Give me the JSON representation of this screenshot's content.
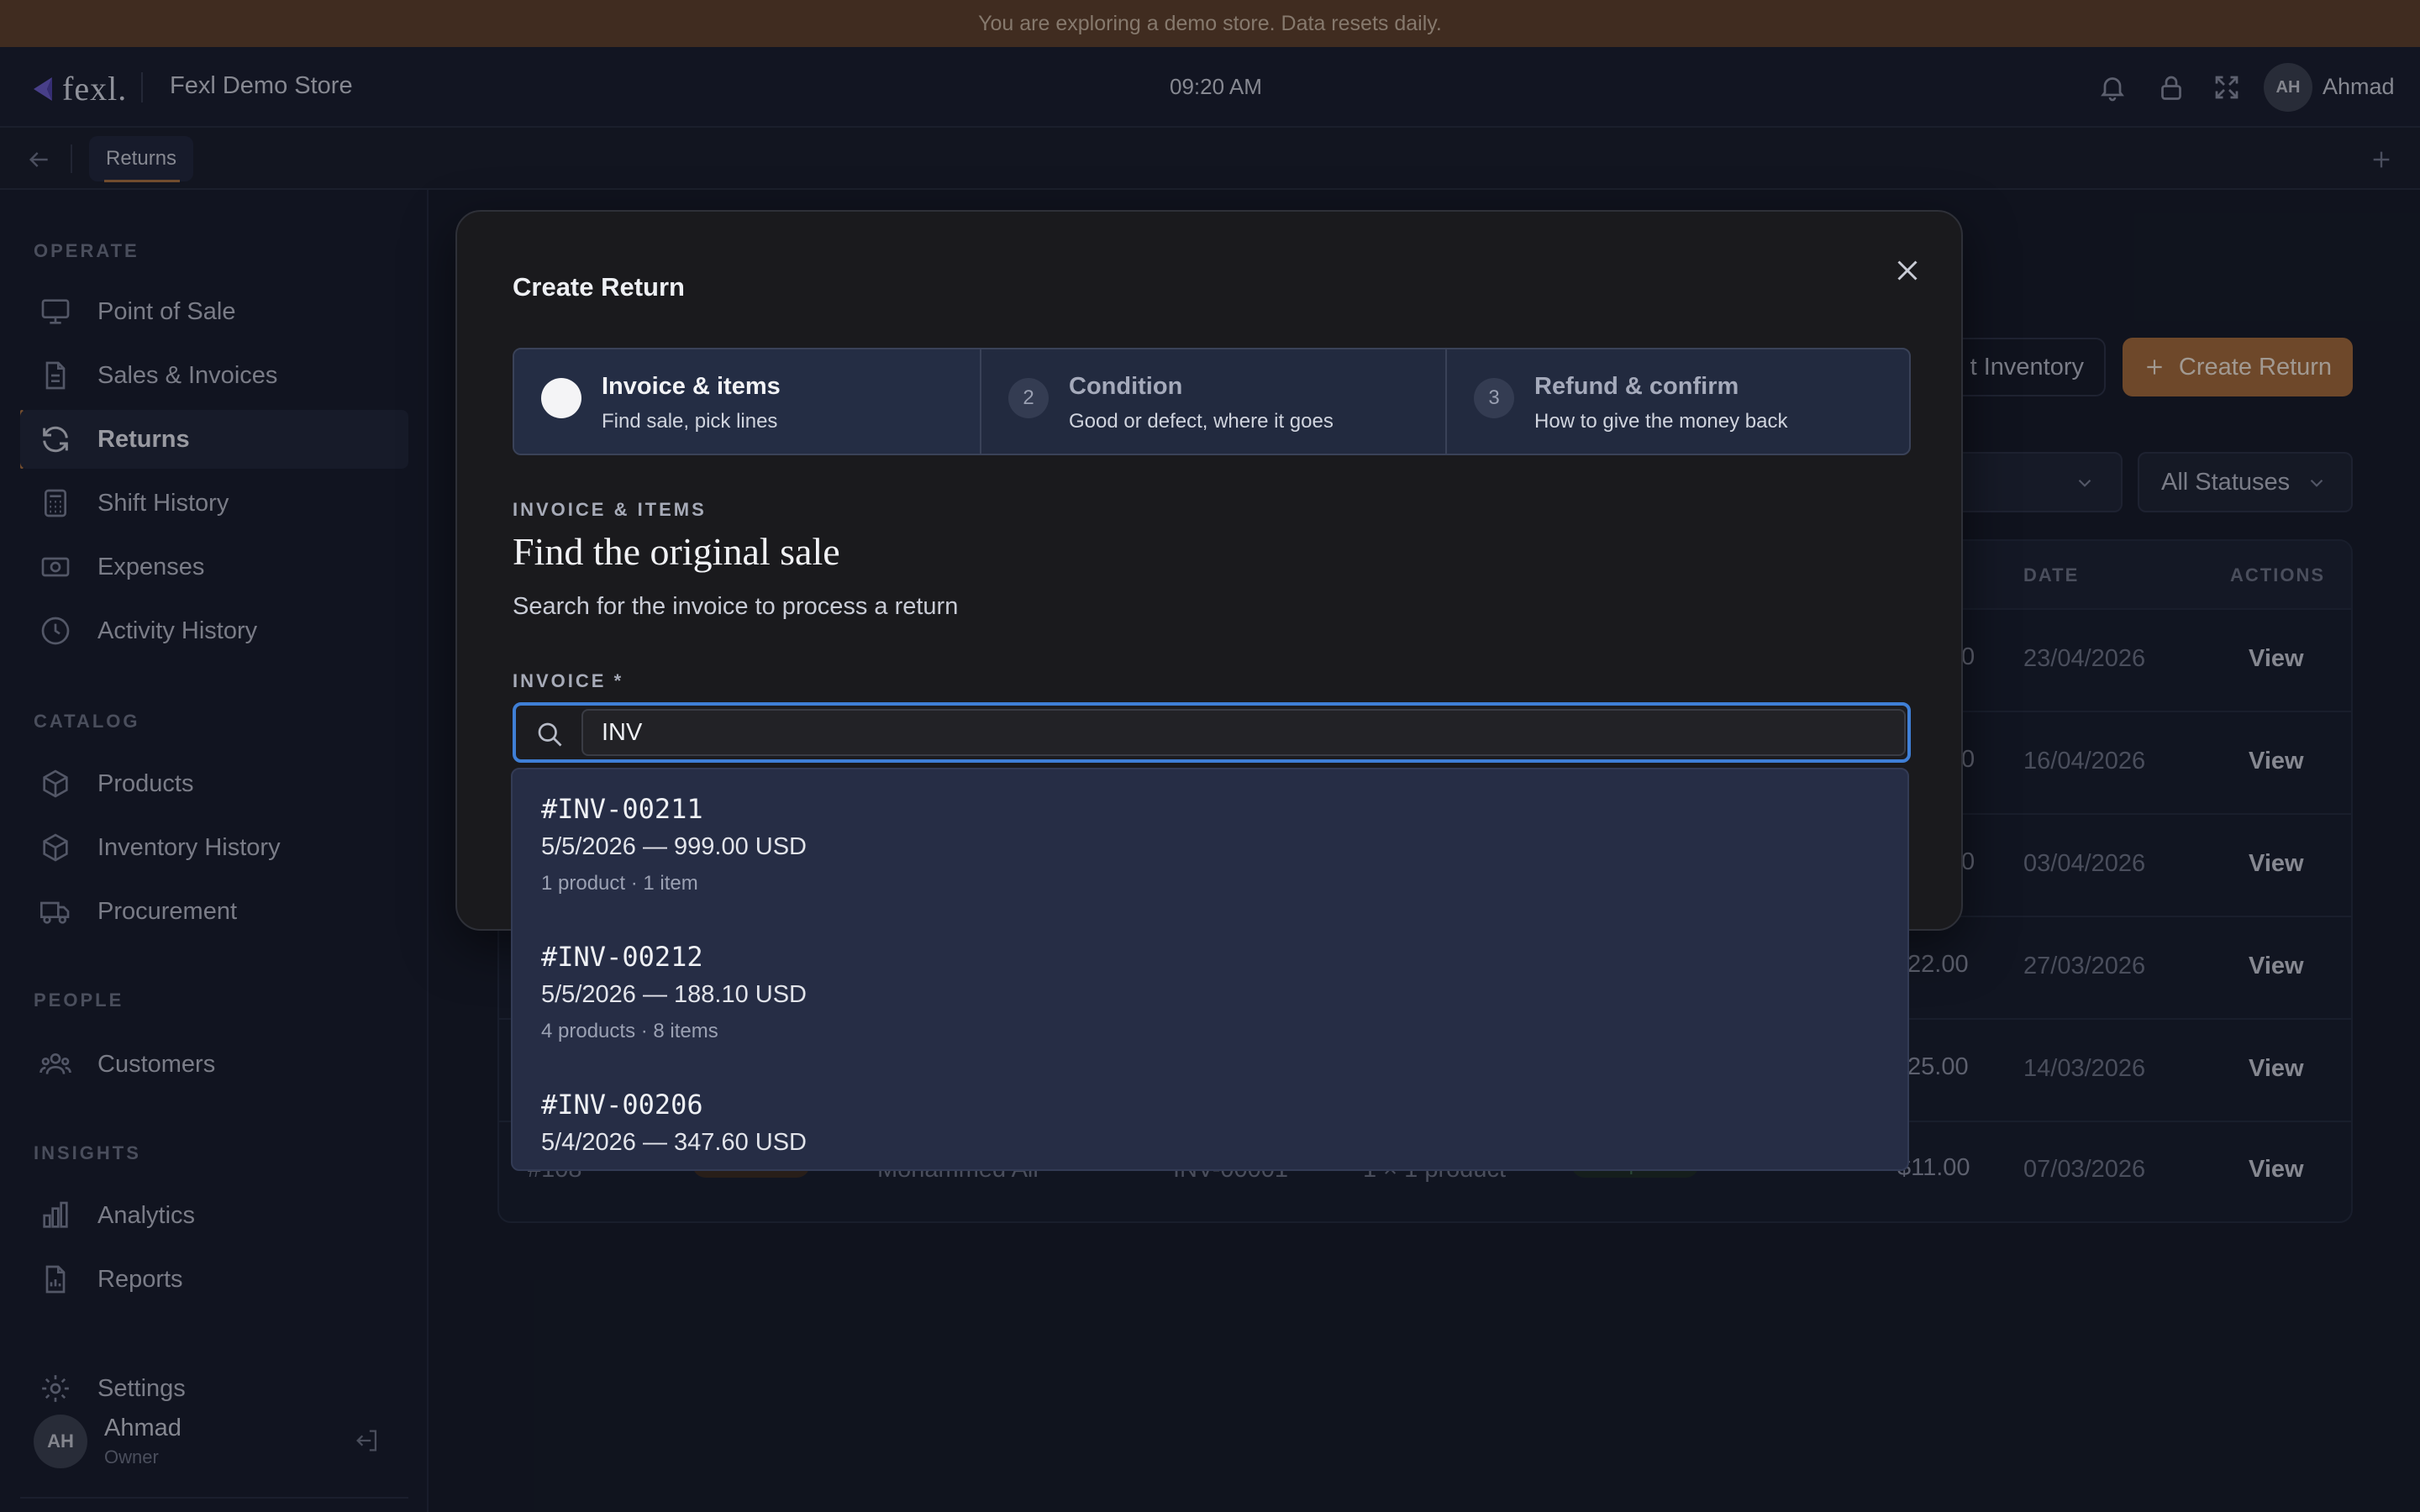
{
  "banner": {
    "text": "You are exploring a demo store. Data resets daily."
  },
  "topbar": {
    "logo_text": "fexl.",
    "store_name": "Fexl Demo Store",
    "time": "09:20 AM",
    "user_initials": "AH",
    "user_name": "Ahmad"
  },
  "tabs": {
    "active_label": "Returns"
  },
  "sidebar": {
    "sections": [
      {
        "title": "OPERATE"
      },
      {
        "title": "CATALOG"
      },
      {
        "title": "PEOPLE"
      },
      {
        "title": "INSIGHTS"
      }
    ],
    "items": [
      {
        "label": "Point of Sale",
        "icon": "monitor-icon"
      },
      {
        "label": "Sales & Invoices",
        "icon": "document-icon"
      },
      {
        "label": "Returns",
        "icon": "refresh-icon",
        "active": true
      },
      {
        "label": "Shift History",
        "icon": "calculator-icon"
      },
      {
        "label": "Expenses",
        "icon": "banknote-icon"
      },
      {
        "label": "Activity History",
        "icon": "clock-icon"
      },
      {
        "label": "Products",
        "icon": "box-icon"
      },
      {
        "label": "Inventory History",
        "icon": "box-icon"
      },
      {
        "label": "Procurement",
        "icon": "truck-icon"
      },
      {
        "label": "Customers",
        "icon": "users-icon"
      },
      {
        "label": "Analytics",
        "icon": "bar-chart-icon"
      },
      {
        "label": "Reports",
        "icon": "report-icon"
      },
      {
        "label": "Settings",
        "icon": "gear-icon"
      }
    ],
    "user": {
      "initials": "AH",
      "name": "Ahmad",
      "role": "Owner"
    }
  },
  "page": {
    "secondary_button": "t Inventory",
    "primary_button": "Create Return",
    "status_filter": "All Statuses",
    "table": {
      "headers": {
        "date": "DATE",
        "actions": "ACTIONS"
      },
      "rows": [
        {
          "amount_partial": "0",
          "date": "23/04/2026",
          "action": "View"
        },
        {
          "amount_partial": "0",
          "date": "16/04/2026",
          "action": "View"
        },
        {
          "amount_partial": "0",
          "date": "03/04/2026",
          "action": "View"
        },
        {
          "amount_partial": "22.00",
          "date": "27/03/2026",
          "action": "View"
        },
        {
          "amount_partial": "25.00",
          "date": "14/03/2026",
          "action": "View"
        },
        {
          "id": "#108",
          "type": "Customer",
          "customer": "Mohammed Ali",
          "invoice": "INV-00001",
          "items": "1 × 1 product",
          "status": "Completed",
          "amount_partial": "$11.00",
          "date": "07/03/2026",
          "action": "View"
        }
      ]
    }
  },
  "modal": {
    "title": "Create Return",
    "steps": [
      {
        "number": "",
        "title": "Invoice & items",
        "subtitle": "Find sale, pick lines"
      },
      {
        "number": "2",
        "title": "Condition",
        "subtitle": "Good or defect, where it goes"
      },
      {
        "number": "3",
        "title": "Refund & confirm",
        "subtitle": "How to give the money back"
      }
    ],
    "eyebrow": "INVOICE & ITEMS",
    "heading": "Find the original sale",
    "subtext": "Search for the invoice to process a return",
    "field_label": "INVOICE *",
    "search_value": "INV",
    "results": [
      {
        "id": "#INV-00211",
        "line": "5/5/2026 — 999.00 USD",
        "meta": "1 product · 1 item"
      },
      {
        "id": "#INV-00212",
        "line": "5/5/2026 — 188.10 USD",
        "meta": "4 products · 8 items"
      },
      {
        "id": "#INV-00206",
        "line": "5/4/2026 — 347.60 USD",
        "meta": ""
      }
    ]
  },
  "colors": {
    "accent": "#a56a38",
    "focus": "#3f7fd6",
    "banner": "#5e3f28"
  }
}
